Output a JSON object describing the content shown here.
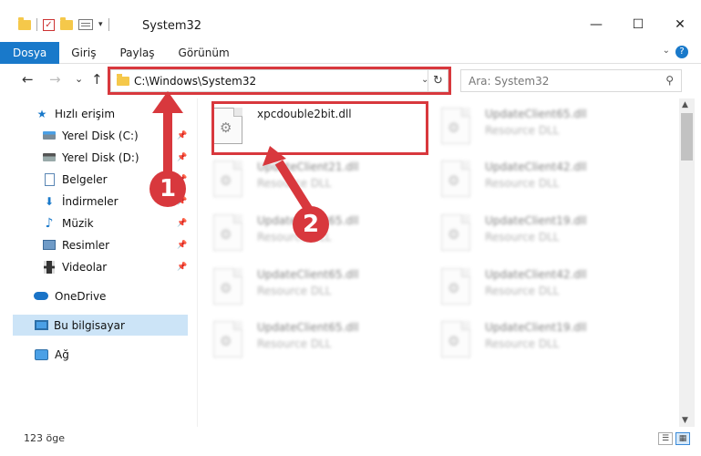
{
  "window": {
    "title": "System32",
    "controls": {
      "minimize": "—",
      "maximize": "☐",
      "close": "✕"
    }
  },
  "quick_access_toolbar": {
    "dropdown_glyph": "▾"
  },
  "ribbon": {
    "tabs": [
      {
        "label": "Dosya",
        "active": true
      },
      {
        "label": "Giriş"
      },
      {
        "label": "Paylaş"
      },
      {
        "label": "Görünüm"
      }
    ],
    "help_glyph": "?",
    "collapse_glyph": "⌄"
  },
  "navigation": {
    "back_glyph": "←",
    "forward_glyph": "→",
    "recent_glyph": "⌄",
    "up_glyph": "↑",
    "address": "C:\\Windows\\System32",
    "address_dropdown_glyph": "⌄",
    "refresh_glyph": "↻",
    "search_placeholder": "Ara: System32",
    "search_glyph": "⚲"
  },
  "sidebar": {
    "items": [
      {
        "label": "Hızlı erişim",
        "icon": "star-icon",
        "glyph": "★",
        "pinned": false
      },
      {
        "label": "Yerel Disk (C:)",
        "icon": "drive-c-icon",
        "pinned": true
      },
      {
        "label": "Yerel Disk (D:)",
        "icon": "drive-d-icon",
        "pinned": true
      },
      {
        "label": "Belgeler",
        "icon": "documents-icon",
        "pinned": true
      },
      {
        "label": "İndirmeler",
        "icon": "downloads-icon",
        "glyph": "⬇",
        "pinned": true
      },
      {
        "label": "Müzik",
        "icon": "music-icon",
        "glyph": "♪",
        "pinned": true
      },
      {
        "label": "Resimler",
        "icon": "pictures-icon",
        "pinned": true
      },
      {
        "label": "Videolar",
        "icon": "videos-icon",
        "pinned": true
      },
      {
        "label": "OneDrive",
        "icon": "onedrive-icon"
      },
      {
        "label": "Bu bilgisayar",
        "icon": "this-pc-icon",
        "selected": true
      },
      {
        "label": "Ağ",
        "icon": "network-icon"
      }
    ],
    "pin_glyph": "📌"
  },
  "files": [
    {
      "name": "xpcdouble2bit.dll",
      "type": "",
      "highlighted": true
    },
    {
      "name": "UpdateClient65.dll",
      "type": "Resource DLL",
      "blurred": true
    },
    {
      "name": "UpdateClient21.dll",
      "type": "Resource DLL",
      "blurred": true
    },
    {
      "name": "UpdateClient42.dll",
      "type": "Resource DLL",
      "blurred": true
    },
    {
      "name": "UpdateClient65.dll",
      "type": "Resource DLL",
      "blurred": true
    },
    {
      "name": "UpdateClient19.dll",
      "type": "Resource DLL",
      "blurred": true
    },
    {
      "name": "UpdateClient65.dll",
      "type": "Resource DLL",
      "blurred": true
    },
    {
      "name": "UpdateClient42.dll",
      "type": "Resource DLL",
      "blurred": true
    },
    {
      "name": "UpdateClient65.dll",
      "type": "Resource DLL",
      "blurred": true
    },
    {
      "name": "UpdateClient19.dll",
      "type": "Resource DLL",
      "blurred": true
    }
  ],
  "scrollbar": {
    "up_glyph": "▲",
    "down_glyph": "▼"
  },
  "status_bar": {
    "item_count": "123 öge",
    "details_view_glyph": "☰",
    "large_icons_view_glyph": "▦"
  },
  "annotations": {
    "callout_1": "1",
    "callout_2": "2",
    "highlight_color": "#d8383d"
  },
  "colors": {
    "accent": "#1979ca",
    "selection": "#cce4f7",
    "annotation": "#d8383d",
    "folder": "#f5c84a"
  }
}
